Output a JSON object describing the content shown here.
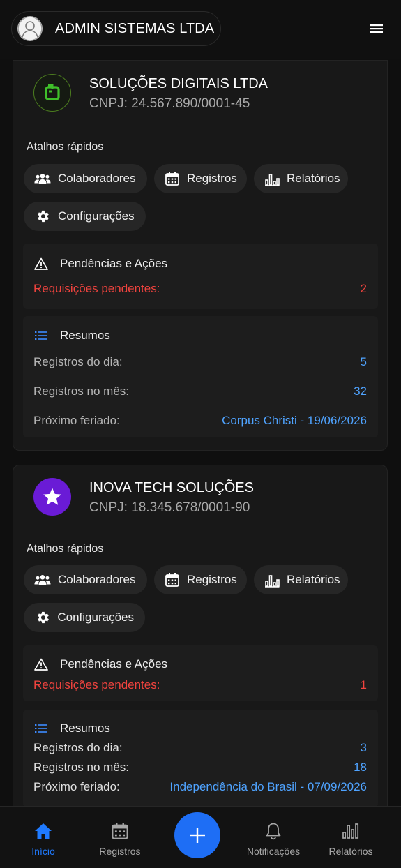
{
  "header": {
    "user_name": "ADMIN SISTEMAS LTDA"
  },
  "companies": [
    {
      "name": "SOLUÇÕES DIGITAIS LTDA",
      "cnpj": "CNPJ: 24.567.890/0001-45",
      "shortcuts_label": "Atalhos rápidos",
      "shortcuts": [
        "Colaboradores",
        "Registros",
        "Relatórios",
        "Configurações"
      ],
      "pending": {
        "title": "Pendências e Ações",
        "label": "Requisições pendentes:",
        "value": "2"
      },
      "summary": {
        "title": "Resumos",
        "rows": [
          {
            "label": "Registros do dia:",
            "value": "5"
          },
          {
            "label": "Registros no mês:",
            "value": "32"
          },
          {
            "label": "Próximo feriado:",
            "value": "Corpus Christi - 19/06/2026"
          }
        ]
      }
    },
    {
      "name": "INOVA TECH SOLUÇÕES",
      "cnpj": "CNPJ: 18.345.678/0001-90",
      "shortcuts_label": "Atalhos rápidos",
      "shortcuts": [
        "Colaboradores",
        "Registros",
        "Relatórios",
        "Configurações"
      ],
      "pending": {
        "title": "Pendências e Ações",
        "label": "Requisições pendentes:",
        "value": "1"
      },
      "summary": {
        "title": "Resumos",
        "rows": [
          {
            "label": "Registros do dia:",
            "value": "3"
          },
          {
            "label": "Registros no mês:",
            "value": "18"
          },
          {
            "label": "Próximo feriado:",
            "value": "Independência do Brasil - 07/09/2026"
          }
        ]
      }
    }
  ],
  "nav": {
    "items": [
      "Início",
      "Registros",
      "Notificações",
      "Relatórios"
    ],
    "active": "Início"
  },
  "colors": {
    "accent": "#1f7aff",
    "danger": "#f0433e",
    "link": "#4fa3ff",
    "background": "#0f0f0f"
  },
  "icons": [
    "user-icon",
    "menu-icon",
    "people-icon",
    "calendar-icon",
    "report-icon",
    "gear-icon",
    "warning-icon",
    "list-icon",
    "home-icon",
    "bell-icon",
    "bar-chart-icon",
    "plus-icon",
    "star-icon",
    "refresh-logo-icon"
  ]
}
